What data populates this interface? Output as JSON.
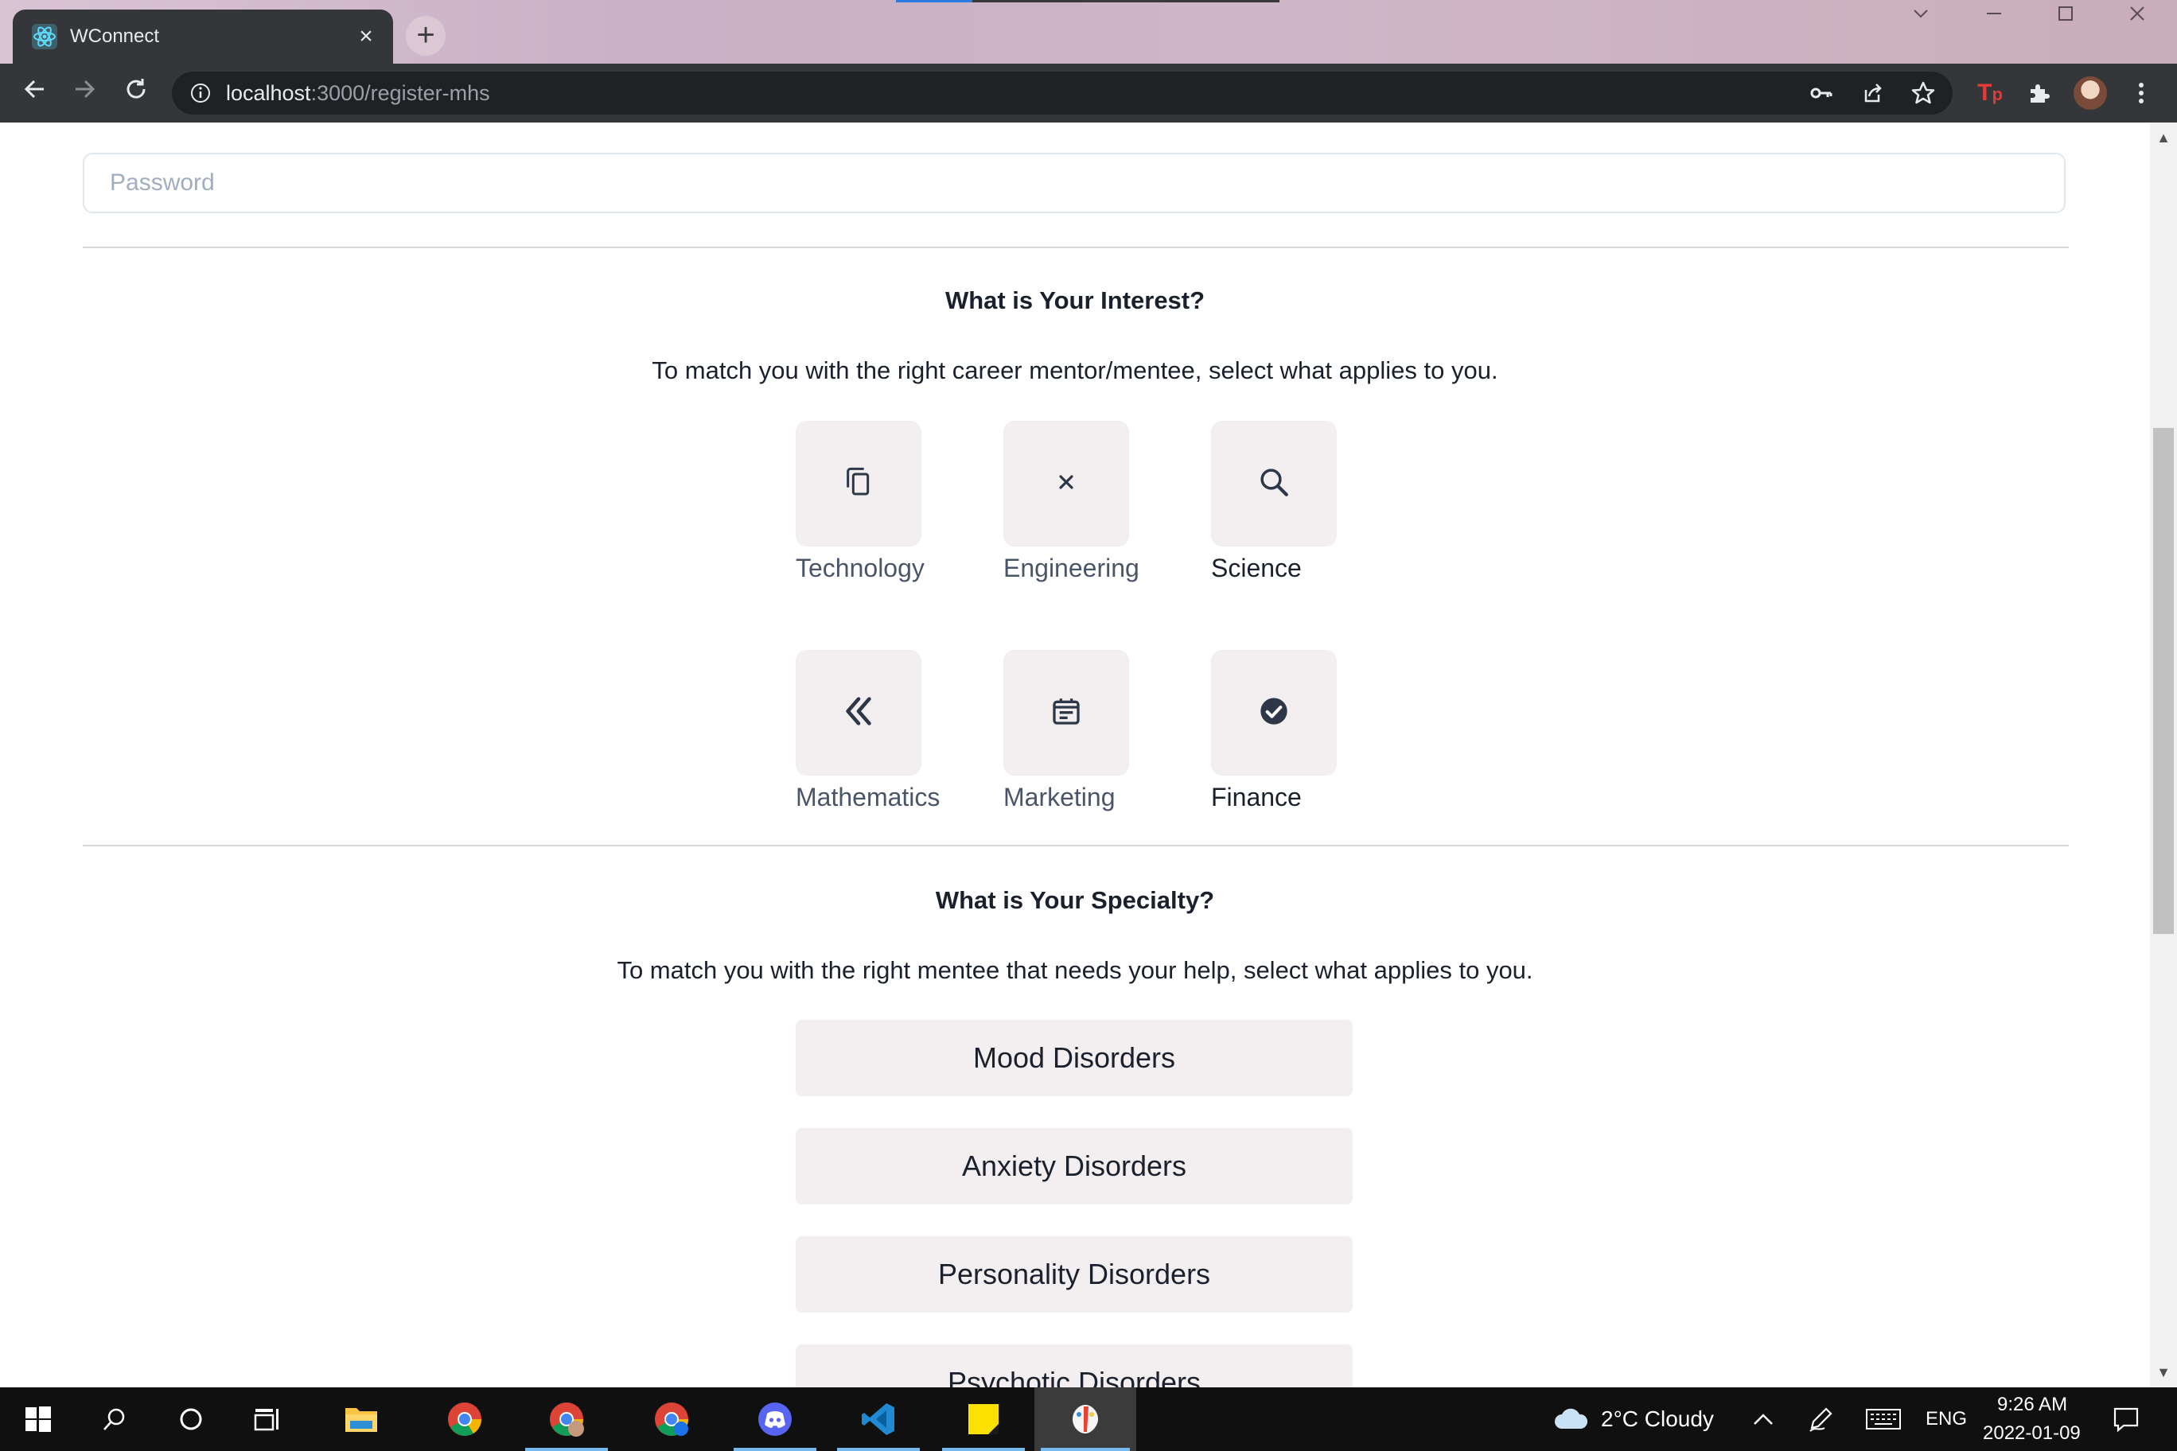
{
  "browser": {
    "tab_title": "WConnect",
    "url_host": "localhost",
    "url_path": ":3000/register-mhs"
  },
  "form": {
    "password_placeholder": "Password"
  },
  "interest": {
    "heading": "What is Your Interest?",
    "subtext": "To match you with the right career mentor/mentee, select what applies to you.",
    "options": [
      {
        "label": "Technology",
        "icon": "copy-icon"
      },
      {
        "label": "Engineering",
        "icon": "close-icon"
      },
      {
        "label": "Science",
        "icon": "search-icon"
      },
      {
        "label": "Mathematics",
        "icon": "double-chevron-left-icon"
      },
      {
        "label": "Marketing",
        "icon": "calendar-icon"
      },
      {
        "label": "Finance",
        "icon": "check-circle-icon"
      }
    ]
  },
  "specialty": {
    "heading": "What is Your Specialty?",
    "subtext": "To match you with the right mentee that needs your help, select what applies to you.",
    "options": [
      "Mood Disorders",
      "Anxiety Disorders",
      "Personality Disorders",
      "Psychotic Disorders"
    ]
  },
  "taskbar": {
    "weather": "2°C  Cloudy",
    "language": "ENG",
    "time": "9:26 AM",
    "date": "2022-01-09",
    "apps": [
      "file-explorer-icon",
      "chrome-icon",
      "chrome-profile-icon",
      "chrome-profile-2-icon",
      "discord-icon",
      "vscode-icon",
      "sticky-notes-icon",
      "paint-icon"
    ]
  },
  "colors": {
    "tile_bg": "#f3eff1",
    "text_dark": "#1a202c",
    "browser_chrome": "#35363a"
  }
}
